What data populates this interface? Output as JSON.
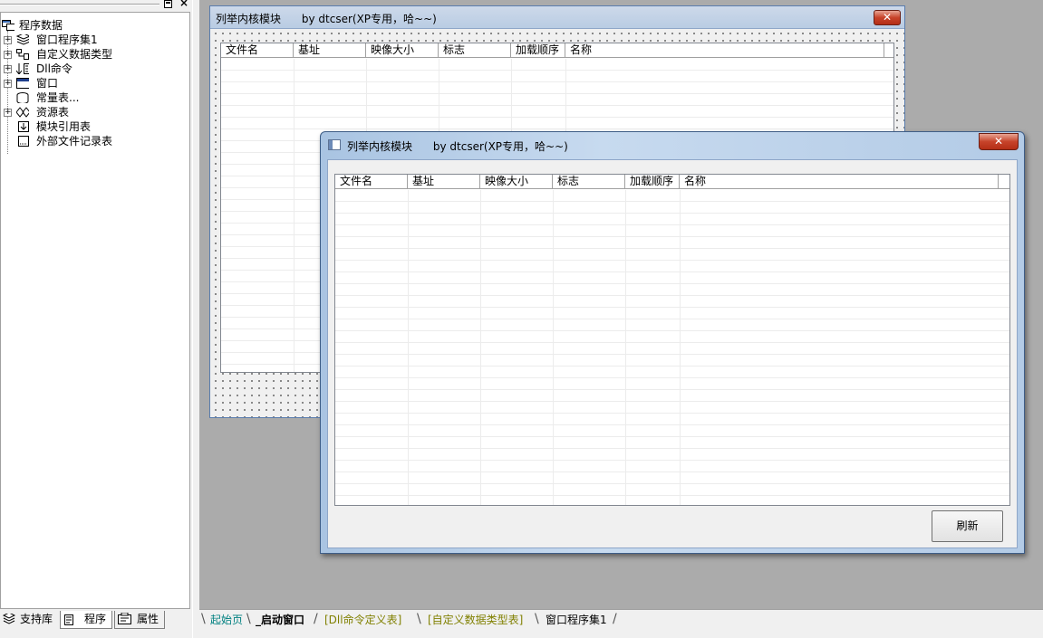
{
  "left_panel": {
    "tree": {
      "root": "程序数据",
      "items": [
        {
          "label": "窗口程序集1",
          "expandable": true,
          "icon": "layers-icon"
        },
        {
          "label": "自定义数据类型",
          "expandable": true,
          "icon": "data-type-icon"
        },
        {
          "label": "Dll命令",
          "expandable": true,
          "icon": "dll-command-icon"
        },
        {
          "label": "窗口",
          "expandable": true,
          "icon": "window-icon"
        },
        {
          "label": "常量表...",
          "expandable": false,
          "icon": "constants-icon"
        },
        {
          "label": "资源表",
          "expandable": true,
          "icon": "resources-icon"
        },
        {
          "label": "模块引用表",
          "expandable": false,
          "icon": "module-ref-icon"
        },
        {
          "label": "外部文件记录表",
          "expandable": false,
          "icon": "external-file-icon"
        }
      ]
    },
    "tabs": [
      "支持库",
      "程序",
      "属性"
    ],
    "active_tab": "程序"
  },
  "design_form": {
    "title": "列举内核模块      by dtcser(XP专用，哈~~)",
    "columns": [
      "文件名",
      "基址",
      "映像大小",
      "标志",
      "加载顺序",
      "名称"
    ]
  },
  "run_window": {
    "title": "列举内核模块      by dtcser(XP专用，哈~~)",
    "columns": [
      "文件名",
      "基址",
      "映像大小",
      "标志",
      "加载顺序",
      "名称"
    ],
    "refresh_label": "刷新",
    "close_label": "✕"
  },
  "bottom_tabs": [
    {
      "label": "起始页",
      "color": "#008080"
    },
    {
      "label": "_启动窗口",
      "color": "#000000",
      "active": true
    },
    {
      "label": "[Dll命令定义表]",
      "color": "#808000"
    },
    {
      "label": "[自定义数据类型表]",
      "color": "#808000"
    },
    {
      "label": "窗口程序集1",
      "color": "#000000"
    }
  ]
}
